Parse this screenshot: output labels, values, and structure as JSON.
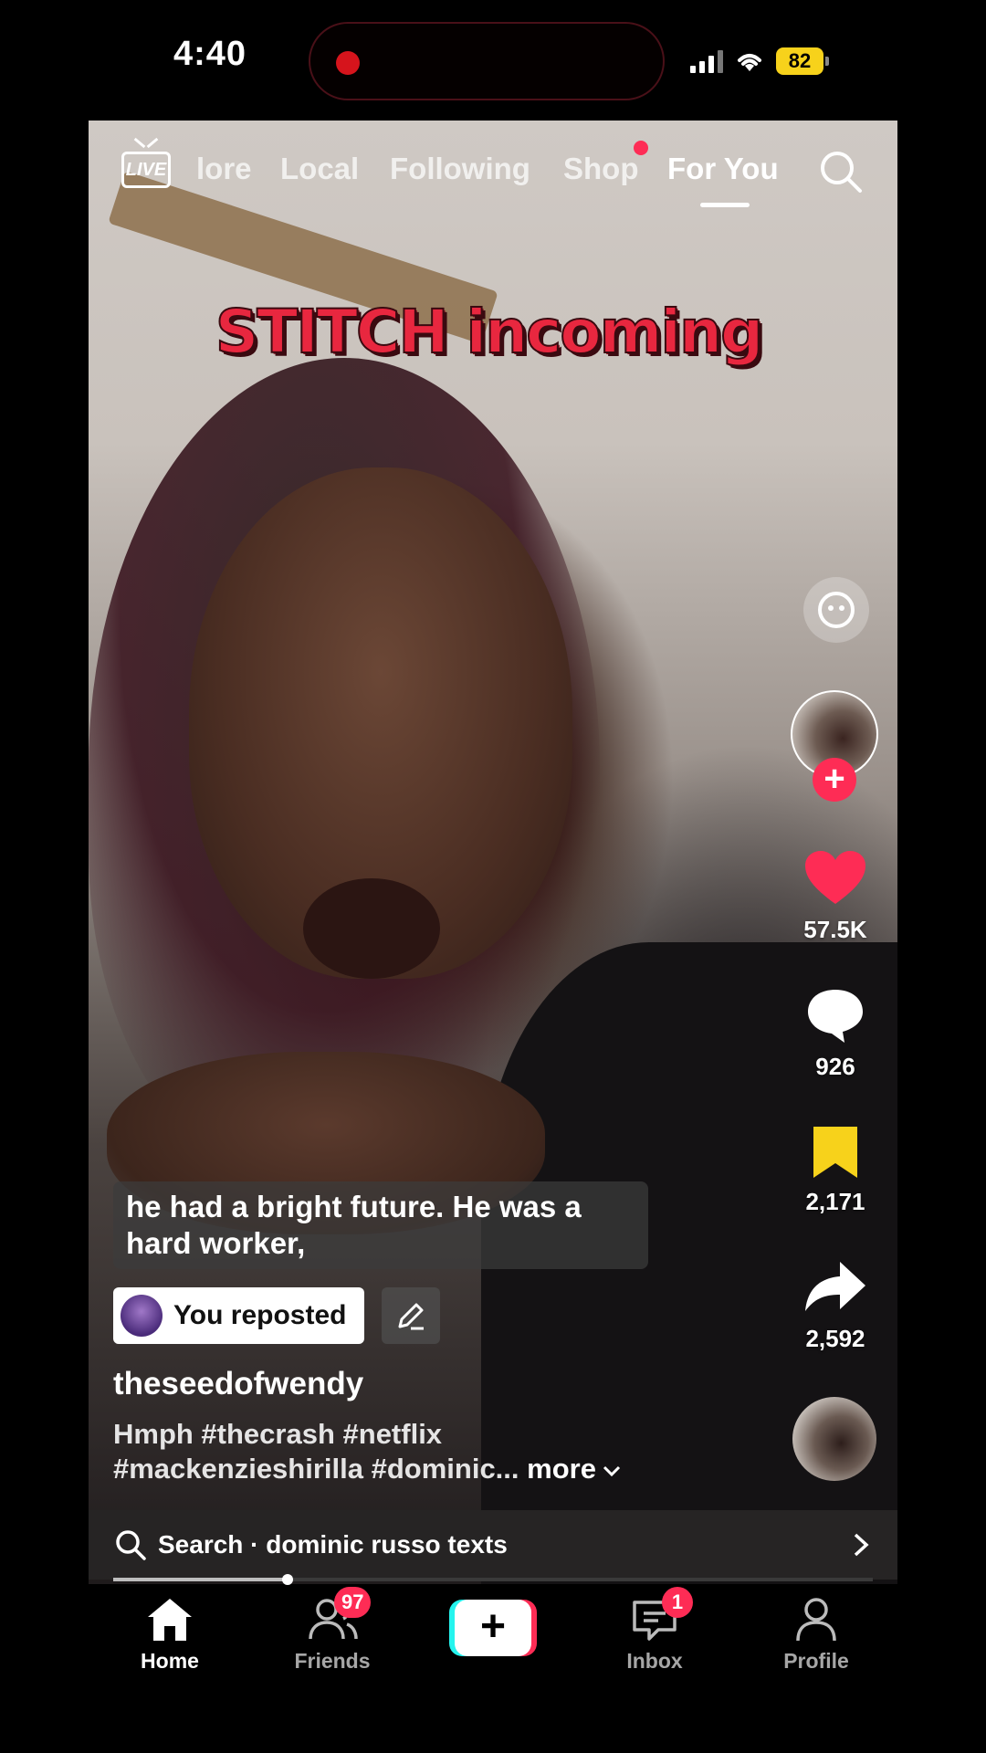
{
  "status_bar": {
    "time": "4:40",
    "battery": "82"
  },
  "top_nav": {
    "live": "LIVE",
    "tabs": [
      {
        "label": "lore"
      },
      {
        "label": "Local"
      },
      {
        "label": "Following"
      },
      {
        "label": "Shop"
      },
      {
        "label": "For You"
      }
    ]
  },
  "video": {
    "sticker_text": "STITCH incoming",
    "subtitle": "he had a bright future. He was a hard worker,"
  },
  "actions": {
    "likes": "57.5K",
    "comments": "926",
    "saves": "2,171",
    "shares": "2,592"
  },
  "post": {
    "repost_label": "You reposted",
    "username": "theseedofwendy",
    "description": "Hmph #thecrash #netflix #mackenzieshirilla #dominic...",
    "more_label": "more"
  },
  "search_suggestion": {
    "text": "Search · dominic russo texts"
  },
  "playback": {
    "progress": 0.23
  },
  "tab_bar": {
    "items": [
      {
        "label": "Home"
      },
      {
        "label": "Friends",
        "badge": "97"
      },
      {
        "label": "Inbox",
        "badge": "1"
      },
      {
        "label": "Profile"
      }
    ]
  },
  "colors": {
    "accent": "#fe2c55",
    "bookmark": "#f7d21b",
    "cyan": "#25f4ee"
  }
}
